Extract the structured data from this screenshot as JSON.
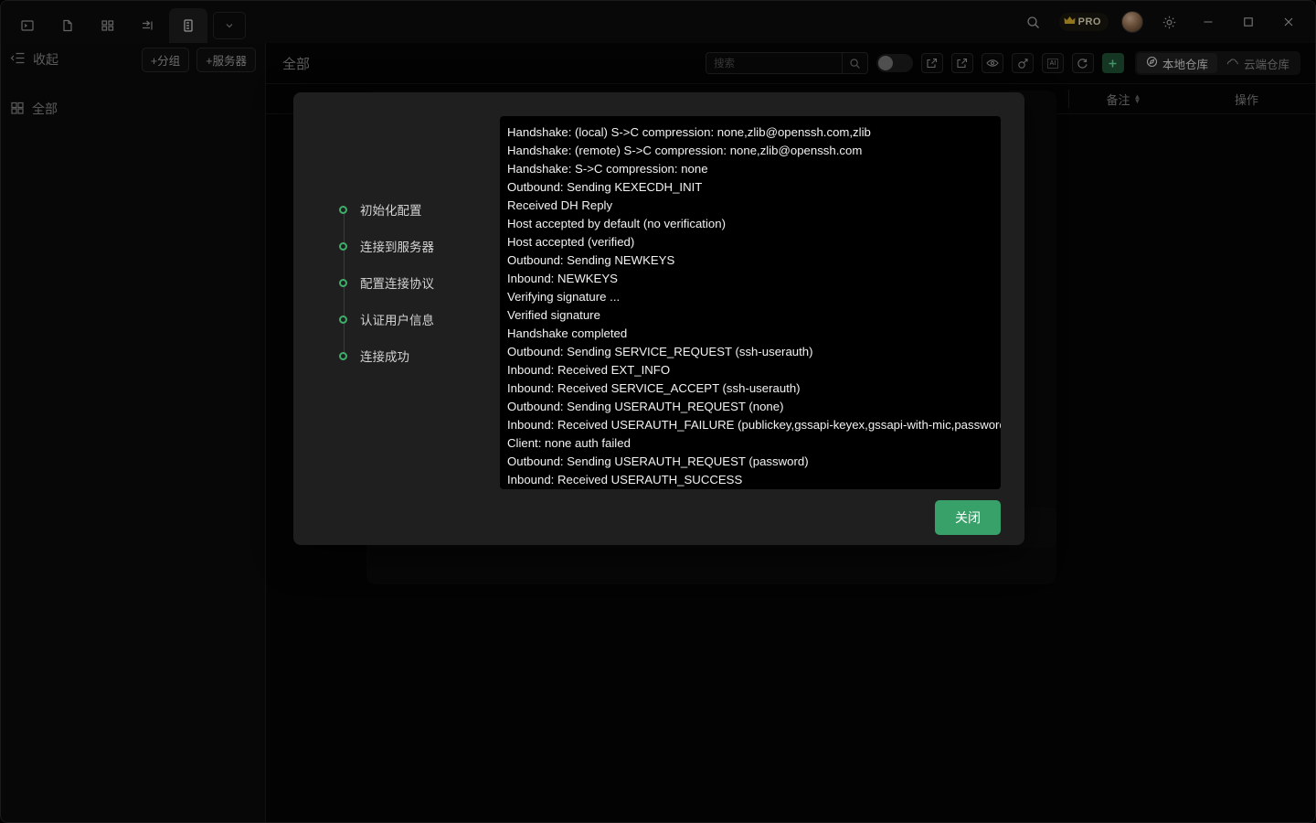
{
  "titlebar": {
    "tabs": [
      {
        "name": "terminal-tab",
        "icon": "terminal-icon",
        "active": false
      },
      {
        "name": "file-tab",
        "icon": "file-icon",
        "active": false
      },
      {
        "name": "apps-tab",
        "icon": "grid-icon",
        "active": false
      },
      {
        "name": "transfer-tab",
        "icon": "transfer-icon",
        "active": false
      },
      {
        "name": "servers-tab",
        "icon": "server-list-icon",
        "active": true
      }
    ],
    "caret_icon": "chevron-down-icon",
    "search_icon": "search-icon",
    "pro_label": "PRO",
    "crown_icon": "crown-icon",
    "avatar_icon": "avatar",
    "settings_icon": "gear-icon",
    "minimize_icon": "minimize-icon",
    "maximize_icon": "maximize-icon",
    "close_icon": "close-icon"
  },
  "sidebar": {
    "collapse_label": "收起",
    "collapse_icon": "collapse-list-icon",
    "add_group_label": "+分组",
    "add_server_label": "+服务器",
    "all_label": "全部",
    "all_icon": "grid-icon"
  },
  "main": {
    "title": "全部",
    "search": {
      "placeholder": "搜索",
      "value": "",
      "icon": "search-icon"
    },
    "toggle": {
      "name": "view-toggle",
      "state": "off"
    },
    "tools": [
      {
        "name": "open-external-button",
        "icon": "open-external-icon",
        "glyph": "⇱"
      },
      {
        "name": "import-button",
        "icon": "import-icon",
        "glyph": "⇲"
      },
      {
        "name": "preview-button",
        "icon": "eye-icon",
        "glyph": "◉"
      },
      {
        "name": "key-button",
        "icon": "key-icon",
        "glyph": "⚲"
      },
      {
        "name": "ai-button",
        "icon": "ai-icon",
        "glyph": "AI"
      },
      {
        "name": "refresh-button",
        "icon": "refresh-icon",
        "glyph": "↻"
      },
      {
        "name": "add-button",
        "icon": "plus-icon",
        "glyph": "+"
      }
    ],
    "repos": [
      {
        "label": "本地仓库",
        "icon": "compass-icon",
        "active": true
      },
      {
        "label": "云端仓库",
        "icon": "cloud-icon",
        "active": false
      }
    ],
    "table_headers": {
      "remark": "备注",
      "operation": "操作",
      "sort_icon": "sort-arrows-icon"
    }
  },
  "modal": {
    "name": "connection-log-dialog",
    "steps": [
      {
        "label": "初始化配置",
        "state": "done"
      },
      {
        "label": "连接到服务器",
        "state": "done"
      },
      {
        "label": "配置连接协议",
        "state": "done"
      },
      {
        "label": "认证用户信息",
        "state": "done"
      },
      {
        "label": "连接成功",
        "state": "done"
      }
    ],
    "log_lines": [
      "Handshake: (local) S->C compression: none,zlib@openssh.com,zlib",
      "Handshake: (remote) S->C compression: none,zlib@openssh.com",
      "Handshake: S->C compression: none",
      "Outbound: Sending KEXECDH_INIT",
      "Received DH Reply",
      "Host accepted by default (no verification)",
      "Host accepted (verified)",
      "Outbound: Sending NEWKEYS",
      "Inbound: NEWKEYS",
      "Verifying signature ...",
      "Verified signature",
      "Handshake completed",
      "Outbound: Sending SERVICE_REQUEST (ssh-userauth)",
      "Inbound: Received EXT_INFO",
      "Inbound: Received SERVICE_ACCEPT (ssh-userauth)",
      "Outbound: Sending USERAUTH_REQUEST (none)",
      "Inbound: Received USERAUTH_FAILURE (publickey,gssapi-keyex,gssapi-with-mic,password)",
      "Client: none auth failed",
      "Outbound: Sending USERAUTH_REQUEST (password)",
      "Inbound: Received USERAUTH_SUCCESS"
    ],
    "close_button": "关闭"
  },
  "colors": {
    "accent_green": "#38a169",
    "step_green": "#3fae6a",
    "window_bg": "#070707",
    "modal_bg": "#1f1f1f",
    "log_bg": "#000000"
  }
}
